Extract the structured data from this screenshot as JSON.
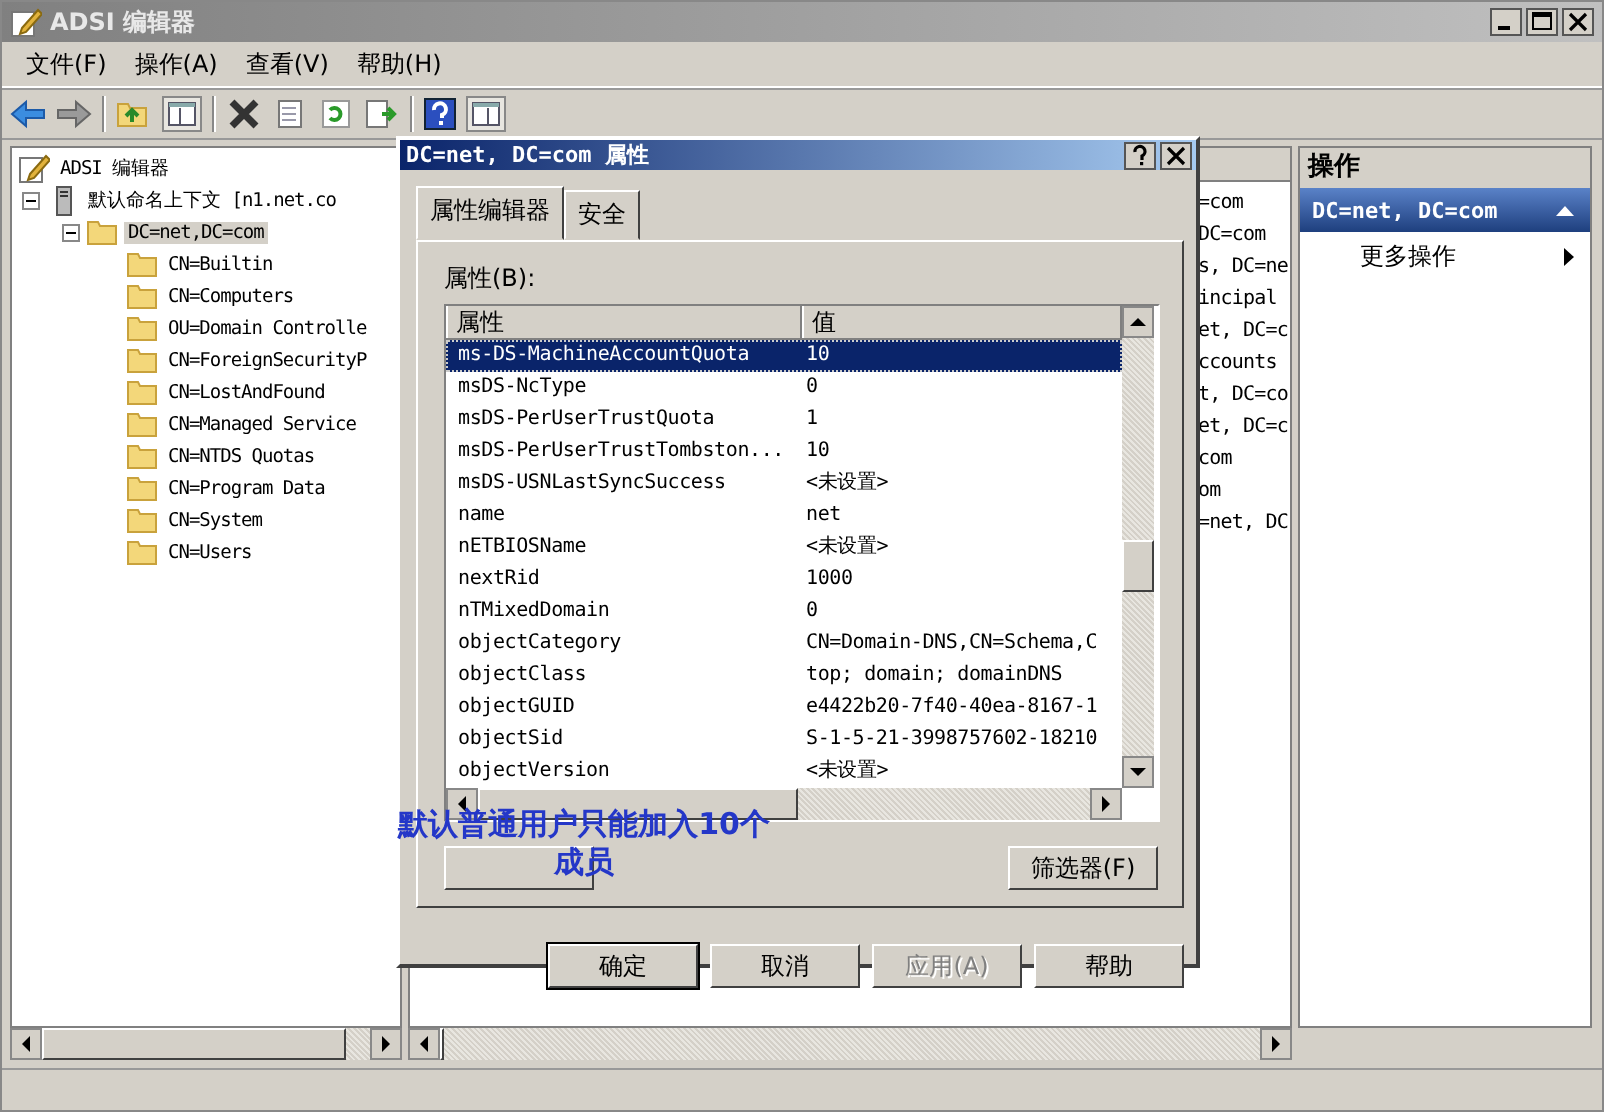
{
  "window": {
    "title": "ADSI 编辑器"
  },
  "menu": [
    {
      "label": "文件(F)"
    },
    {
      "label": "操作(A)"
    },
    {
      "label": "查看(V)"
    },
    {
      "label": "帮助(H)"
    }
  ],
  "tree": {
    "label": "ADSI 编辑器",
    "kind": "root",
    "selected": false,
    "children": [
      {
        "label": "默认命名上下文 [n1.net.co",
        "kind": "server",
        "expanded": true,
        "selected": false,
        "children": [
          {
            "label": "DC=net,DC=com",
            "kind": "folder",
            "expanded": true,
            "selected": true,
            "children": [
              {
                "label": "CN=Builtin",
                "kind": "folder",
                "selected": false
              },
              {
                "label": "CN=Computers",
                "kind": "folder",
                "selected": false
              },
              {
                "label": "OU=Domain Controlle",
                "kind": "folder",
                "selected": false
              },
              {
                "label": "CN=ForeignSecurityP",
                "kind": "folder",
                "selected": false
              },
              {
                "label": "CN=LostAndFound",
                "kind": "folder",
                "selected": false
              },
              {
                "label": "CN=Managed Service",
                "kind": "folder",
                "selected": false
              },
              {
                "label": "CN=NTDS Quotas",
                "kind": "folder",
                "selected": false
              },
              {
                "label": "CN=Program Data",
                "kind": "folder",
                "selected": false
              },
              {
                "label": "CN=System",
                "kind": "folder",
                "selected": false
              },
              {
                "label": "CN=Users",
                "kind": "folder",
                "selected": false
              }
            ]
          }
        ]
      }
    ]
  },
  "list_items": [
    "=com",
    "DC=com",
    "s, DC=ne",
    "incipal",
    "et, DC=c",
    "ccounts",
    "t, DC=co",
    "et, DC=c",
    "com",
    "om",
    "=net, DC"
  ],
  "actions": {
    "title": "操作",
    "group": "DC=net, DC=com",
    "items": [
      {
        "label": "更多操作"
      }
    ]
  },
  "dialog": {
    "title": "DC=net, DC=com 属性",
    "tabs": [
      {
        "label": "属性编辑器",
        "selected": true
      },
      {
        "label": "安全",
        "selected": false
      }
    ],
    "list_label": "属性(B):",
    "columns": [
      "属性",
      "值"
    ],
    "rows": [
      {
        "attribute": "ms-DS-MachineAccountQuota",
        "value": "10",
        "selected": true
      },
      {
        "attribute": "msDS-NcType",
        "value": "0",
        "selected": false
      },
      {
        "attribute": "msDS-PerUserTrustQuota",
        "value": "1",
        "selected": false
      },
      {
        "attribute": "msDS-PerUserTrustTombston...",
        "value": "10",
        "selected": false
      },
      {
        "attribute": "msDS-USNLastSyncSuccess",
        "value": "<未设置>",
        "selected": false
      },
      {
        "attribute": "name",
        "value": "net",
        "selected": false
      },
      {
        "attribute": "nETBIOSName",
        "value": "<未设置>",
        "selected": false
      },
      {
        "attribute": "nextRid",
        "value": "1000",
        "selected": false
      },
      {
        "attribute": "nTMixedDomain",
        "value": "0",
        "selected": false
      },
      {
        "attribute": "objectCategory",
        "value": "CN=Domain-DNS,CN=Schema,C",
        "selected": false
      },
      {
        "attribute": "objectClass",
        "value": "top; domain; domainDNS",
        "selected": false
      },
      {
        "attribute": "objectGUID",
        "value": "e4422b20-7f40-40ea-8167-1",
        "selected": false
      },
      {
        "attribute": "objectSid",
        "value": "S-1-5-21-3998757602-18210",
        "selected": false
      },
      {
        "attribute": "objectVersion",
        "value": "<未设置>",
        "selected": false
      }
    ],
    "filter_button": "筛选器(F)",
    "buttons": [
      {
        "label": "确定",
        "default": true,
        "disabled": false
      },
      {
        "label": "取消",
        "default": false,
        "disabled": false
      },
      {
        "label": "应用(A)",
        "default": false,
        "disabled": true
      },
      {
        "label": "帮助",
        "default": false,
        "disabled": false
      }
    ]
  },
  "annotation": [
    "默认普通用户只能加入10个",
    "成员"
  ]
}
